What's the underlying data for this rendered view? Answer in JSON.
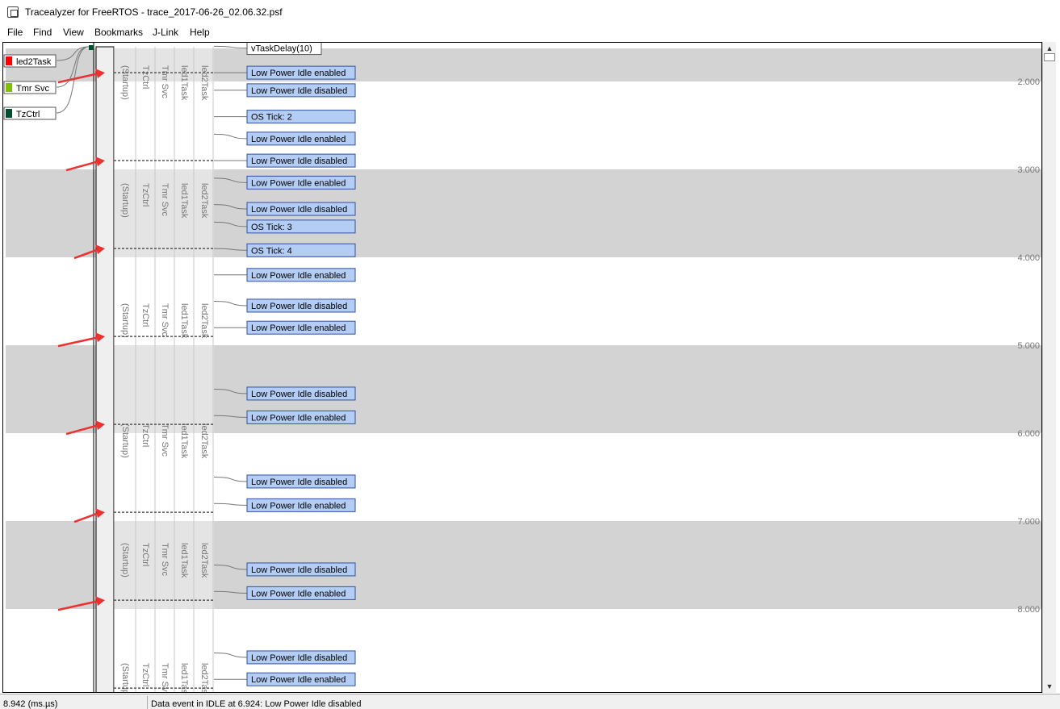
{
  "window": {
    "title": "Tracealyzer for FreeRTOS - trace_2017-06-26_02.06.32.psf"
  },
  "menu": [
    "File",
    "Find",
    "View",
    "Bookmarks",
    "J-Link",
    "Help"
  ],
  "legend": [
    {
      "label": "led2Task",
      "color": "#ff0000"
    },
    {
      "label": "Tmr Svc",
      "color": "#80c000"
    },
    {
      "label": "TzCtrl",
      "color": "#005030"
    }
  ],
  "column_labels": [
    "(Startup)",
    "TzCtrl",
    "Tmr Svc",
    "led1Task",
    "led2Task"
  ],
  "time_ticks": [
    {
      "t": 2,
      "label": "2.000"
    },
    {
      "t": 3,
      "label": "3.000"
    },
    {
      "t": 4,
      "label": "4.000"
    },
    {
      "t": 5,
      "label": "5.000"
    },
    {
      "t": 6,
      "label": "6.000"
    },
    {
      "t": 7,
      "label": "7.000"
    },
    {
      "t": 8,
      "label": "8.000"
    }
  ],
  "gray_bands": [
    [
      1.62,
      2.0
    ],
    [
      3.0,
      4.0
    ],
    [
      5.0,
      6.0
    ],
    [
      7.0,
      8.0
    ]
  ],
  "activation_marks": [
    1.9,
    2.9,
    3.9,
    4.9,
    5.9,
    6.9,
    7.9,
    8.9
  ],
  "arrow_marks": [
    1.9,
    2.9,
    3.9,
    4.9,
    5.9,
    6.9,
    7.9
  ],
  "events": [
    {
      "label": "vTaskDelay(10)",
      "t": 1.62,
      "style": "api"
    },
    {
      "label": "Low Power Idle enabled",
      "t": 1.9,
      "style": "user"
    },
    {
      "label": "Low Power Idle disabled",
      "t": 2.1,
      "style": "user"
    },
    {
      "label": "OS Tick: 2",
      "t": 2.4,
      "style": "user"
    },
    {
      "label": "Low Power Idle enabled",
      "t": 2.65,
      "style": "user"
    },
    {
      "label": "Low Power Idle disabled",
      "t": 2.9,
      "style": "user"
    },
    {
      "label": "Low Power Idle enabled",
      "t": 3.15,
      "style": "user"
    },
    {
      "label": "Low Power Idle disabled",
      "t": 3.45,
      "style": "user"
    },
    {
      "label": "OS Tick: 3",
      "t": 3.65,
      "style": "user"
    },
    {
      "label": "OS Tick: 4",
      "t": 3.92,
      "style": "user"
    },
    {
      "label": "Low Power Idle enabled",
      "t": 4.2,
      "style": "user"
    },
    {
      "label": "Low Power Idle disabled",
      "t": 4.55,
      "style": "user"
    },
    {
      "label": "Low Power Idle enabled",
      "t": 4.8,
      "style": "user"
    },
    {
      "label": "Low Power Idle disabled",
      "t": 5.55,
      "style": "user"
    },
    {
      "label": "Low Power Idle enabled",
      "t": 5.82,
      "style": "user"
    },
    {
      "label": "Low Power Idle disabled",
      "t": 6.55,
      "style": "user"
    },
    {
      "label": "Low Power Idle enabled",
      "t": 6.82,
      "style": "user"
    },
    {
      "label": "Low Power Idle disabled",
      "t": 7.55,
      "style": "user"
    },
    {
      "label": "Low Power Idle enabled",
      "t": 7.82,
      "style": "user"
    },
    {
      "label": "Low Power Idle disabled",
      "t": 8.55,
      "style": "user"
    },
    {
      "label": "Low Power Idle enabled",
      "t": 8.8,
      "style": "user"
    }
  ],
  "status": {
    "cursor_time": "8.942 (ms.µs)",
    "event_info": "Data event in IDLE at 6.924: Low Power Idle disabled"
  },
  "colors": {
    "band_gray": "#d3d3d3",
    "event_fill": "#b4cdf5",
    "event_border": "#3050a0",
    "arrow": "#ee3030"
  }
}
